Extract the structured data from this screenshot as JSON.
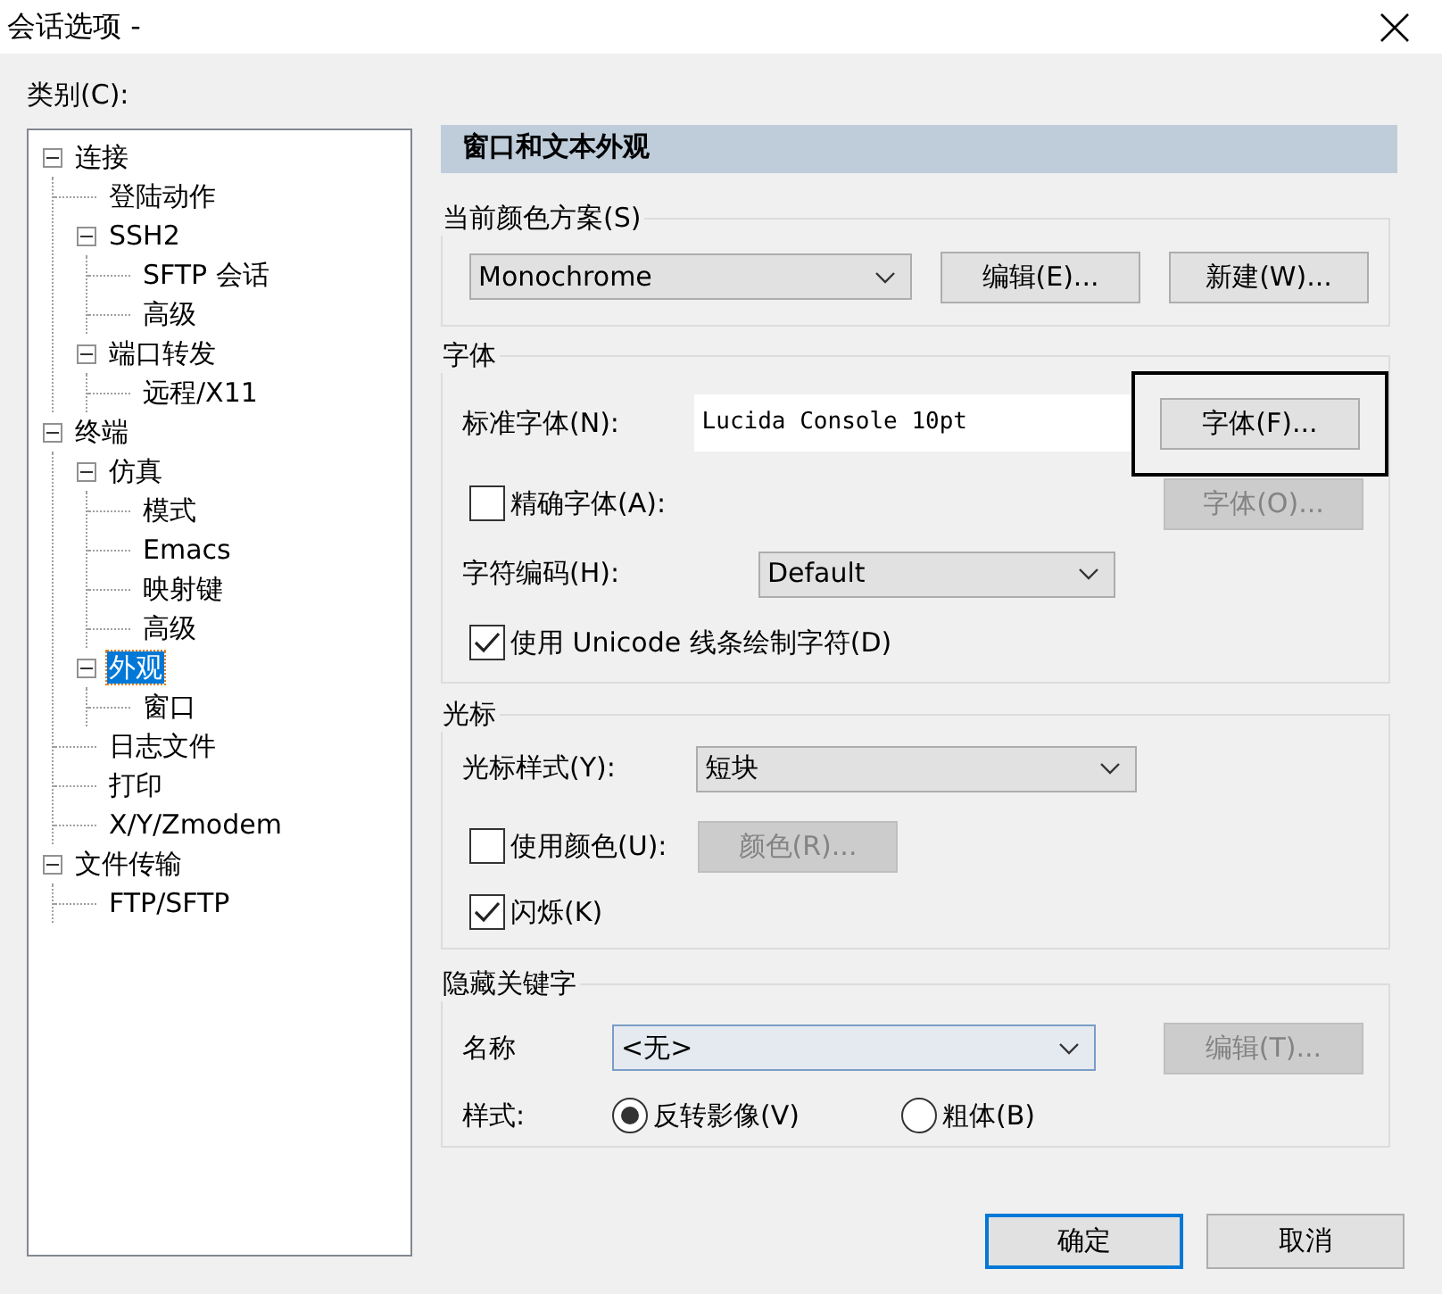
{
  "window": {
    "title": "会话选项 -"
  },
  "category_label": "类别(C):",
  "tree": [
    {
      "label": "连接",
      "expanded": true,
      "selected": false,
      "children": [
        {
          "label": "登陆动作",
          "selected": false
        },
        {
          "label": "SSH2",
          "expanded": true,
          "selected": false,
          "children": [
            {
              "label": "SFTP 会话",
              "selected": false
            },
            {
              "label": "高级",
              "selected": false
            }
          ]
        },
        {
          "label": "端口转发",
          "expanded": true,
          "selected": false,
          "children": [
            {
              "label": "远程/X11",
              "selected": false
            }
          ]
        }
      ]
    },
    {
      "label": "终端",
      "expanded": true,
      "selected": false,
      "children": [
        {
          "label": "仿真",
          "expanded": true,
          "selected": false,
          "children": [
            {
              "label": "模式",
              "selected": false
            },
            {
              "label": "Emacs",
              "selected": false
            },
            {
              "label": "映射键",
              "selected": false
            },
            {
              "label": "高级",
              "selected": false
            }
          ]
        },
        {
          "label": "外观",
          "expanded": true,
          "selected": true,
          "children": [
            {
              "label": "窗口",
              "selected": false
            }
          ]
        },
        {
          "label": "日志文件",
          "selected": false
        },
        {
          "label": "打印",
          "selected": false
        },
        {
          "label": "X/Y/Zmodem",
          "selected": false
        }
      ]
    },
    {
      "label": "文件传输",
      "expanded": true,
      "selected": false,
      "children": [
        {
          "label": "FTP/SFTP",
          "selected": false
        }
      ]
    }
  ],
  "panel": {
    "title": "窗口和文本外观",
    "color_scheme": {
      "legend": "当前颜色方案(S)",
      "value": "Monochrome",
      "edit_button": {
        "label": "编辑(E)...",
        "disabled": false
      },
      "new_button": {
        "label": "新建(W)...",
        "disabled": false
      }
    },
    "font": {
      "legend": "字体",
      "standard_label": "标准字体(N):",
      "standard_value": "Lucida Console 10pt",
      "font_button": {
        "label": "字体(F)...",
        "disabled": false,
        "focused": true
      },
      "precise": {
        "label": "精确字体(A):",
        "checked": false
      },
      "precise_button": {
        "label": "字体(O)...",
        "disabled": true
      },
      "encoding_label": "字符编码(H):",
      "encoding_value": "Default",
      "unicode": {
        "label": "使用 Unicode 线条绘制字符(D)",
        "checked": true
      }
    },
    "cursor": {
      "legend": "光标",
      "style_label": "光标样式(Y):",
      "style_value": "短块",
      "use_color": {
        "label": "使用颜色(U):",
        "checked": false
      },
      "color_button": {
        "label": "颜色(R)...",
        "disabled": true
      },
      "blink": {
        "label": "闪烁(K)",
        "checked": true
      }
    },
    "keywords": {
      "legend": "隐藏关键字",
      "name_label": "名称",
      "name_value": "<无>",
      "edit_button": {
        "label": "编辑(T)...",
        "disabled": true
      },
      "style_label": "样式:",
      "styles": [
        {
          "label": "反转影像(V)",
          "selected": true
        },
        {
          "label": "粗体(B)",
          "selected": false
        }
      ]
    }
  },
  "buttons": [
    {
      "label": "确定",
      "default": true
    },
    {
      "label": "取消",
      "default": false
    }
  ]
}
